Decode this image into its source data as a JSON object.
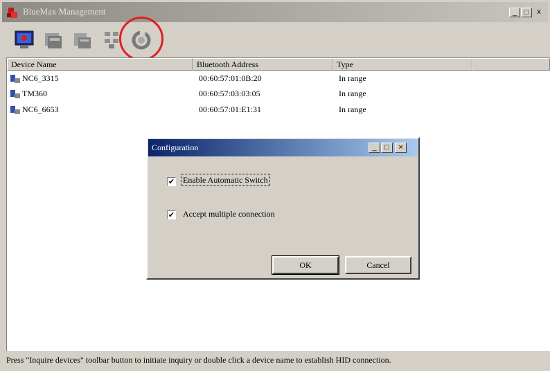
{
  "window": {
    "title": "BlueMax Management",
    "min_label": "_",
    "max_label": "□",
    "close_label": "x"
  },
  "toolbar": {
    "tools": [
      "monitor-icon",
      "device-icon",
      "device-disconnect-icon",
      "network-icon",
      "refresh-config-icon"
    ]
  },
  "list": {
    "columns": [
      "Device Name",
      "Bluetooth Address",
      "Type"
    ],
    "rows": [
      {
        "name": "NC6_3315",
        "address": "00:60:57:01:0B:20",
        "type": "In range"
      },
      {
        "name": "TM360",
        "address": "00:60:57:03:03:05",
        "type": "In range"
      },
      {
        "name": "NC6_6653",
        "address": "00:60:57:01:E1:31",
        "type": "In range"
      }
    ]
  },
  "dialog": {
    "title": "Configuration",
    "min_label": "_",
    "max_label": "□",
    "close_label": "×",
    "options": [
      {
        "label": "Enable Automatic Switch",
        "checked": true,
        "mark": "✔"
      },
      {
        "label": "Accept multiple connection",
        "checked": true,
        "mark": "✔"
      }
    ],
    "ok_label": "OK",
    "cancel_label": "Cancel"
  },
  "status": {
    "text": "Press \"Inquire devices\" toolbar button to initiate inquiry or double click a device name to establish HID connection."
  },
  "colors": {
    "title_gradient_start": "#0a246a",
    "title_gradient_end": "#a6caf0",
    "highlight_circle": "#e02020"
  }
}
